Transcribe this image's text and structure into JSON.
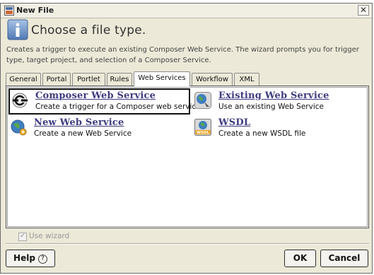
{
  "window": {
    "title": "New File",
    "close_label": "✕"
  },
  "header": {
    "title": "Choose a file type."
  },
  "description": "Creates a trigger to execute an existing Composer Web Service. The wizard prompts you for trigger type, target project, and selection of a Composer Service.",
  "tabs": [
    {
      "label": "General"
    },
    {
      "label": "Portal"
    },
    {
      "label": "Portlet"
    },
    {
      "label": "Rules"
    },
    {
      "label": "Web Services"
    },
    {
      "label": "Workflow"
    },
    {
      "label": "XML"
    }
  ],
  "active_tab": "Web Services",
  "items": [
    {
      "name": "Composer Web Service",
      "desc": "Create a trigger for a Composer web service",
      "icon": "composer-service-icon",
      "selected": true
    },
    {
      "name": "Existing Web Service",
      "desc": "Use an existing Web Service",
      "icon": "existing-service-icon"
    },
    {
      "name": "New Web Service",
      "desc": "Create a new Web Service",
      "icon": "new-service-icon"
    },
    {
      "name": "WSDL",
      "desc": "Create a new WSDL file",
      "icon": "wsdl-icon",
      "icon_text": "WSDL"
    }
  ],
  "wizard": {
    "label": "Use wizard",
    "checked": true,
    "enabled": false
  },
  "buttons": {
    "help": "Help",
    "help_glyph": "?",
    "ok": "OK",
    "cancel": "Cancel"
  }
}
